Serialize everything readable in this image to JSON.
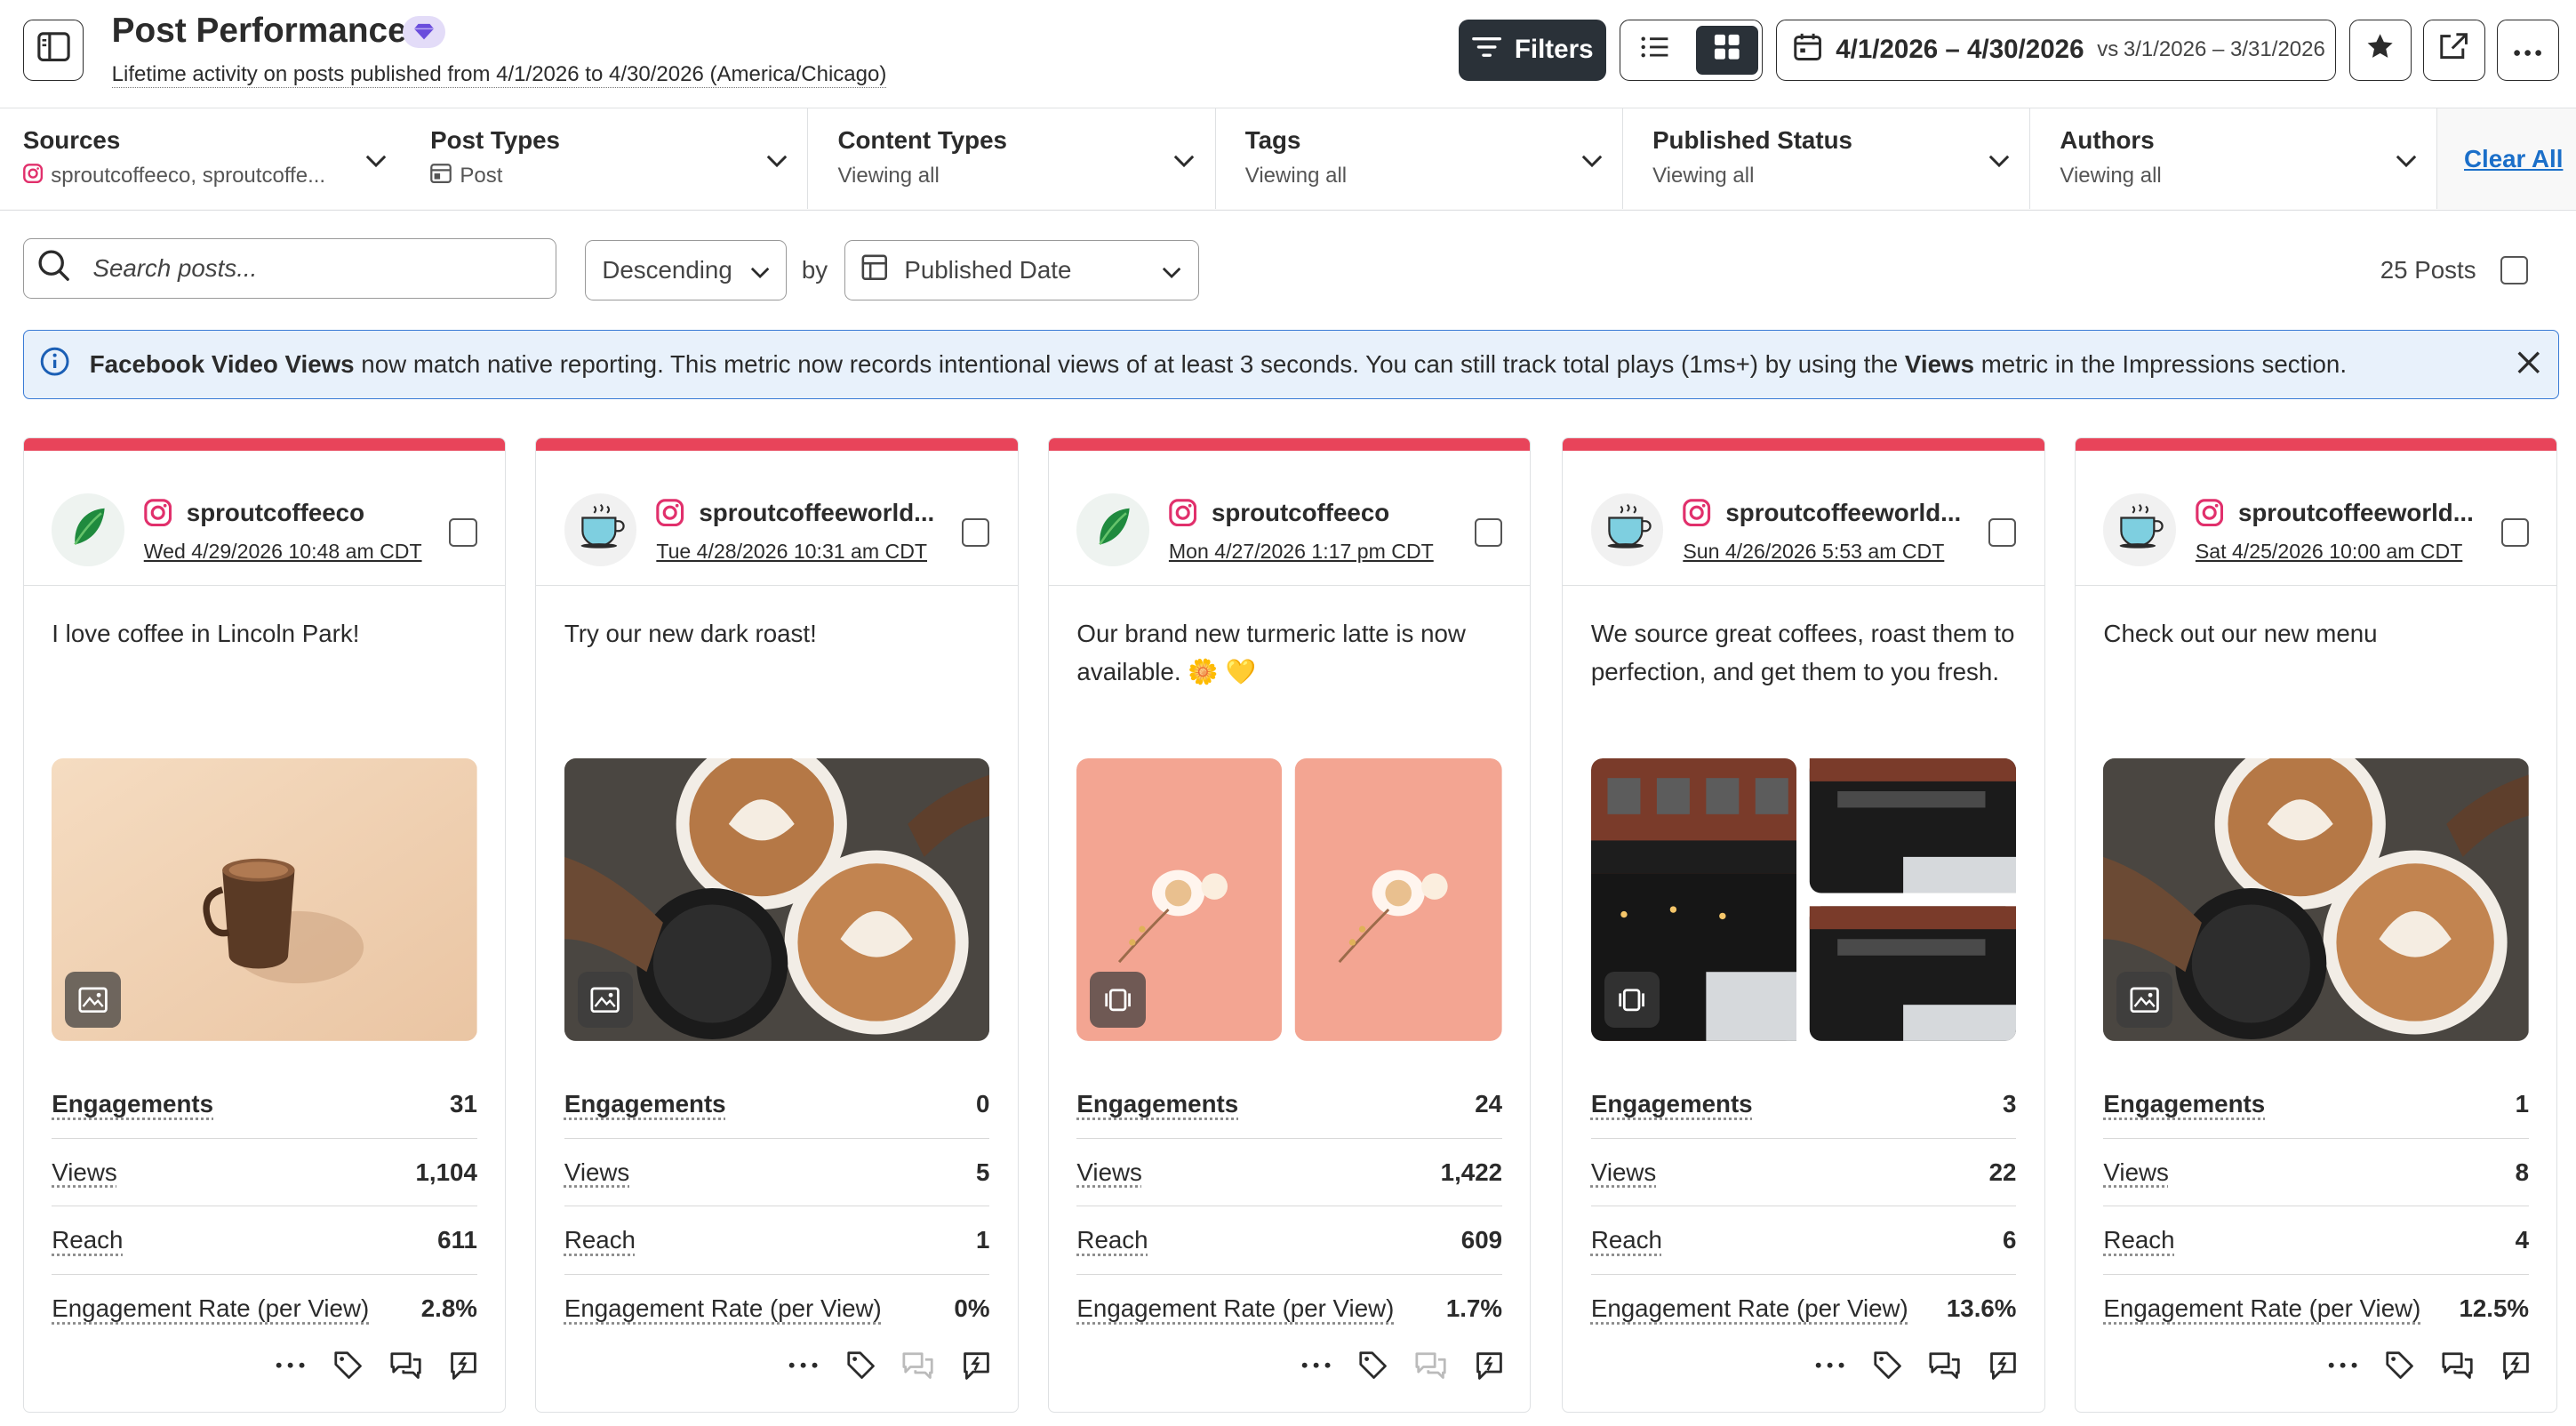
{
  "header": {
    "title": "Post Performance",
    "subtitle": "Lifetime activity on posts published from 4/1/2026 to 4/30/2026 (America/Chicago)",
    "filters_label": "Filters",
    "date_range": "4/1/2026 – 4/30/2026",
    "compare_prefix": "vs",
    "compare_range": "3/1/2026 – 3/31/2026"
  },
  "filters": [
    {
      "label": "Sources",
      "value": "sproutcoffeeco, sproutcoffe..."
    },
    {
      "label": "Post Types",
      "value": "Post"
    },
    {
      "label": "Content Types",
      "value": "Viewing all"
    },
    {
      "label": "Tags",
      "value": "Viewing all"
    },
    {
      "label": "Published Status",
      "value": "Viewing all"
    },
    {
      "label": "Authors",
      "value": "Viewing all"
    }
  ],
  "clear_all": "Clear All",
  "toolbar": {
    "search_placeholder": "Search posts...",
    "sort_order": "Descending",
    "by": "by",
    "sort_field": "Published Date",
    "posts_count": "25 Posts"
  },
  "banner": {
    "bold_start": "Facebook Video Views",
    "text_mid": " now match native reporting. This metric now records intentional views of at least 3 seconds. You can still track total plays (1ms+) by using the ",
    "bold_mid": "Views",
    "text_end": " metric in the Impressions section."
  },
  "metric_labels": {
    "engagements": "Engagements",
    "views": "Views",
    "reach": "Reach",
    "engagement_rate": "Engagement Rate (per View)"
  },
  "posts": [
    {
      "account": "sproutcoffeeco",
      "date": "Wed 4/29/2026 10:48 am CDT",
      "text": "I love coffee in Lincoln Park!",
      "media_type": "image-icon",
      "engagements": "31",
      "views": "1,104",
      "reach": "611",
      "engagement_rate": "2.8%"
    },
    {
      "account": "sproutcoffeeworld...",
      "date": "Tue 4/28/2026 10:31 am CDT",
      "text": "Try our new dark roast!",
      "media_type": "image-icon",
      "engagements": "0",
      "views": "5",
      "reach": "1",
      "engagement_rate": "0%"
    },
    {
      "account": "sproutcoffeeco",
      "date": "Mon 4/27/2026 1:17 pm CDT",
      "text": "Our brand new turmeric latte is now available. 🌼 💛",
      "media_type": "carousel-icon",
      "engagements": "24",
      "views": "1,422",
      "reach": "609",
      "engagement_rate": "1.7%"
    },
    {
      "account": "sproutcoffeeworld...",
      "date": "Sun 4/26/2026 5:53 am CDT",
      "text": "We source great coffees, roast them to perfection, and get them to you fresh.",
      "media_type": "carousel-icon",
      "engagements": "3",
      "views": "22",
      "reach": "6",
      "engagement_rate": "13.6%"
    },
    {
      "account": "sproutcoffeeworld...",
      "date": "Sat 4/25/2026 10:00 am CDT",
      "text": "Check out our new menu",
      "media_type": "image-icon",
      "engagements": "1",
      "views": "8",
      "reach": "4",
      "engagement_rate": "12.5%"
    }
  ],
  "colors": {
    "card_top_accent": "#e8445a",
    "link": "#1b6fc9",
    "dark_button": "#2a3138",
    "banner_border": "#3a7bd5",
    "banner_bg": "#e8f1fb",
    "instagram": "#e1306c"
  }
}
